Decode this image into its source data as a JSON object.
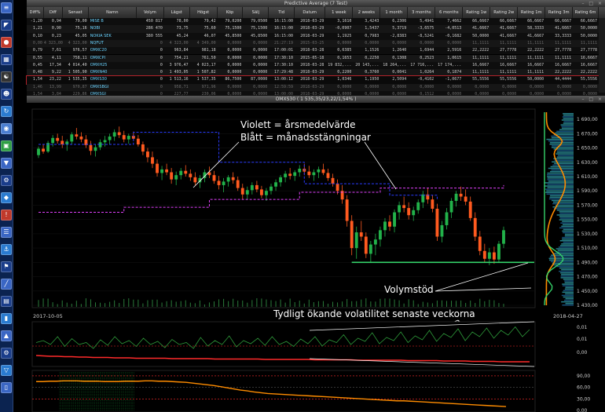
{
  "table_window": {
    "title": "Predictive Average (7 Test)",
    "controls": "– □ ×",
    "columns": [
      "Diff%",
      "Diff",
      "Senast",
      "Namn",
      "Volym",
      "Lägst",
      "Högst",
      "Köp",
      "Sälj",
      "Tid",
      "Datum",
      "1 week",
      "2 weeks",
      "1 month",
      "3 months",
      "6 months",
      "Rating 1w",
      "Rating 2w",
      "Rating 1m",
      "Rating 3m",
      "Rating 6m"
    ],
    "rows": [
      [
        "-1,20",
        "0,94",
        "79,00",
        "MISE B",
        "450 817",
        "78,00",
        "79,42",
        "79,0200",
        "79,0500",
        "16:15:00",
        "2018-03-29",
        "3,1610",
        "3,4243",
        "6,2306",
        "5,4941",
        "7,4662",
        "66,6667",
        "66,6667",
        "66,6667",
        "66,6667",
        "66,6667"
      ],
      [
        "1,21",
        "0,90",
        "75,16",
        "NOBI",
        "286 470",
        "73,75",
        "75,60",
        "75,1500",
        "75,1500",
        "16:15:00",
        "2018-03-29",
        "-0,0907",
        "1,5437",
        "5,3719",
        "-3,6575",
        "-4,0513",
        "41,6667",
        "41,6667",
        "58,3333",
        "41,6667",
        "50,0000"
      ],
      [
        "0,10",
        "0,23",
        "45,05",
        "NOKIA SEK",
        "380 555",
        "45,24",
        "46,07",
        "45,8500",
        "45,8500",
        "16:15:00",
        "2018-03-29",
        "1,1925",
        "0,7983",
        "-2,8383",
        "-8,5241",
        "-0,1682",
        "50,0000",
        "41,6667",
        "41,6667",
        "33,3333",
        "50,0000"
      ],
      [
        "0,00",
        "4 323,00",
        "4 323,00",
        "NQFUT",
        "0",
        "4 323,00",
        "4 349,00",
        "0,0000",
        "0,0000",
        "21:27:19",
        "2015-03-25",
        "0,0000",
        "0,0000",
        "0,0000",
        "0,0000",
        "0,0000",
        "11,1111",
        "11,1111",
        "11,1111",
        "11,1111",
        "11,1111"
      ],
      [
        "0,79",
        "7,61",
        "976,57",
        "OMXC20",
        "0",
        "963,84",
        "981,18",
        "0,0000",
        "0,0000",
        "17:00:01",
        "2018-03-28",
        "0,6385",
        "1,1526",
        "1,2640",
        "1,6944",
        "2,5916",
        "22,2222",
        "27,7778",
        "22,2222",
        "27,7778",
        "27,7778"
      ],
      [
        "0,55",
        "4,11",
        "758,11",
        "OMXCPI",
        "0",
        "754,21",
        "761,50",
        "0,0000",
        "0,0000",
        "17:30:10",
        "2015-05-18",
        "0,1653",
        "0,2250",
        "0,1308",
        "0,2523",
        "1,0615",
        "11,1111",
        "11,1111",
        "11,1111",
        "11,1111",
        "16,6667"
      ],
      [
        "0,45",
        "17,34",
        "4 014,40",
        "OMXH25",
        "0",
        "3 976,47",
        "4 023,17",
        "0,0000",
        "0,0000",
        "17:30:10",
        "2018-03-28",
        "19 832,...",
        "20 143,...",
        "18 264,...",
        "17 716,...",
        "17 174,...",
        "16,6667",
        "16,6667",
        "16,6667",
        "16,6667",
        "16,6667"
      ],
      [
        "0,48",
        "9,22",
        "1 505,90",
        "OMXN40",
        "0",
        "1 493,05",
        "1 507,82",
        "0,0000",
        "0,0000",
        "17:29:48",
        "2018-03-29",
        "0,2200",
        "0,3760",
        "0,0041",
        "1,0264",
        "0,1874",
        "11,1111",
        "11,1111",
        "11,1111",
        "22,2222",
        "22,2222"
      ],
      [
        "1,54",
        "23,22",
        "1 535,35",
        "OMXS30",
        "0",
        "1 513,16",
        "1 537,35",
        "86,7500",
        "87,0000",
        "13:00:12",
        "2018-03-29",
        "1,0346",
        "1,1950",
        "2,5094",
        "-0,4102",
        "-1,0677",
        "55,5556",
        "55,5556",
        "50,0000",
        "44,4444",
        "55,5556"
      ],
      [
        "1,46",
        "13,99",
        "970,87",
        "OMXSBGI",
        "0",
        "958,71",
        "971,96",
        "0,0000",
        "0,0000",
        "12:59:59",
        "2018-03-29",
        "0,0000",
        "0,0000",
        "0,0000",
        "0,0000",
        "0,0000",
        "0,0000",
        "0,0000",
        "0,0000",
        "0,0000",
        "0,0000"
      ],
      [
        "1,54",
        "3,84",
        "229,86",
        "OMXSGI",
        "0",
        "227,77",
        "230,06",
        "0,0000",
        "0,0000",
        "13:00:00",
        "2018-03-29",
        "0,0000",
        "0,0000",
        "0,0000",
        "0,1512",
        "0,0000",
        "0,0000",
        "0,0000",
        "0,0000",
        "0,0000",
        "0,0000"
      ]
    ]
  },
  "chart_window": {
    "title": "OMXS30 ( 1 535,35/23,22/1,54% )",
    "controls": "– □ ×",
    "annotations": {
      "violet": "Violett = årsmedelvärde",
      "blue": "Blått = månadsstängningar",
      "volume": "Volymstöd",
      "volatility": "Tydligt ökande volatilitet senaste veckorna"
    },
    "date_start": "2017-10-05",
    "date_end": "2018-04-27",
    "colors": {
      "up": "#22b24a",
      "down": "#ff5a1f",
      "violet": "#e040fb",
      "blue": "#2a3cff",
      "green_line": "#35d36a",
      "vol_red": "#ff2a2a",
      "indicator_orange": "#ff8c00"
    }
  },
  "chart_data": [
    {
      "type": "candlestick",
      "title": "OMXS30 ( 1 535,35/23,22/1,54% )",
      "xlabel": "",
      "ylabel": "",
      "x_range": [
        "2017-10-05",
        "2018-04-27"
      ],
      "ylim": [
        1430,
        1700
      ],
      "y_ticks": [
        "1 690,00",
        "1 670,00",
        "1 650,00",
        "1 630,00",
        "1 610,00",
        "1 590,00",
        "1 570,00",
        "1 550,00",
        "1 530,00",
        "1 510,00",
        "1 490,00",
        "1 470,00",
        "1 450,00",
        "1 430,00"
      ],
      "candles": [
        [
          1640,
          1652,
          1636,
          1649
        ],
        [
          1649,
          1655,
          1642,
          1645
        ],
        [
          1645,
          1660,
          1643,
          1657
        ],
        [
          1657,
          1668,
          1652,
          1664
        ],
        [
          1664,
          1670,
          1656,
          1660
        ],
        [
          1660,
          1667,
          1650,
          1655
        ],
        [
          1655,
          1662,
          1646,
          1659
        ],
        [
          1659,
          1672,
          1655,
          1669
        ],
        [
          1669,
          1678,
          1662,
          1666
        ],
        [
          1666,
          1672,
          1658,
          1662
        ],
        [
          1662,
          1668,
          1650,
          1654
        ],
        [
          1654,
          1660,
          1640,
          1646
        ],
        [
          1646,
          1655,
          1638,
          1651
        ],
        [
          1651,
          1662,
          1647,
          1658
        ],
        [
          1658,
          1667,
          1652,
          1661
        ],
        [
          1661,
          1670,
          1655,
          1666
        ],
        [
          1666,
          1676,
          1660,
          1672
        ],
        [
          1672,
          1680,
          1664,
          1668
        ],
        [
          1668,
          1674,
          1658,
          1662
        ],
        [
          1662,
          1670,
          1656,
          1667
        ],
        [
          1667,
          1673,
          1660,
          1663
        ],
        [
          1663,
          1668,
          1652,
          1655
        ],
        [
          1655,
          1659,
          1640,
          1645
        ],
        [
          1645,
          1650,
          1630,
          1637
        ],
        [
          1637,
          1645,
          1622,
          1628
        ],
        [
          1628,
          1634,
          1610,
          1615
        ],
        [
          1615,
          1625,
          1605,
          1620
        ],
        [
          1620,
          1628,
          1612,
          1616
        ],
        [
          1616,
          1622,
          1600,
          1606
        ],
        [
          1606,
          1617,
          1598,
          1612
        ],
        [
          1612,
          1622,
          1606,
          1618
        ],
        [
          1618,
          1626,
          1610,
          1614
        ],
        [
          1614,
          1620,
          1604,
          1609
        ],
        [
          1609,
          1616,
          1598,
          1602
        ],
        [
          1602,
          1612,
          1594,
          1608
        ],
        [
          1608,
          1620,
          1602,
          1616
        ],
        [
          1616,
          1624,
          1608,
          1612
        ],
        [
          1612,
          1618,
          1600,
          1604
        ],
        [
          1604,
          1611,
          1592,
          1598
        ],
        [
          1598,
          1608,
          1588,
          1603
        ],
        [
          1603,
          1612,
          1596,
          1609
        ],
        [
          1609,
          1616,
          1600,
          1605
        ],
        [
          1605,
          1610,
          1590,
          1594
        ],
        [
          1594,
          1600,
          1578,
          1585
        ],
        [
          1585,
          1596,
          1578,
          1591
        ],
        [
          1591,
          1602,
          1585,
          1598
        ],
        [
          1598,
          1604,
          1588,
          1592
        ],
        [
          1592,
          1597,
          1580,
          1584
        ],
        [
          1584,
          1594,
          1576,
          1590
        ],
        [
          1590,
          1600,
          1585,
          1596
        ],
        [
          1596,
          1606,
          1590,
          1602
        ],
        [
          1602,
          1612,
          1596,
          1609
        ],
        [
          1609,
          1618,
          1602,
          1614
        ],
        [
          1614,
          1622,
          1606,
          1611
        ],
        [
          1611,
          1619,
          1604,
          1616
        ],
        [
          1616,
          1626,
          1610,
          1621
        ],
        [
          1621,
          1628,
          1612,
          1617
        ],
        [
          1617,
          1625,
          1608,
          1612
        ],
        [
          1612,
          1620,
          1604,
          1616
        ],
        [
          1616,
          1624,
          1608,
          1620
        ],
        [
          1620,
          1628,
          1612,
          1615
        ],
        [
          1615,
          1621,
          1604,
          1608
        ],
        [
          1608,
          1614,
          1596,
          1600
        ],
        [
          1600,
          1606,
          1585,
          1590
        ],
        [
          1590,
          1598,
          1572,
          1578
        ],
        [
          1578,
          1584,
          1540,
          1548
        ],
        [
          1548,
          1556,
          1500,
          1510
        ],
        [
          1510,
          1540,
          1495,
          1532
        ],
        [
          1532,
          1548,
          1520,
          1526
        ],
        [
          1526,
          1532,
          1496,
          1502
        ],
        [
          1502,
          1520,
          1490,
          1515
        ],
        [
          1515,
          1530,
          1500,
          1522
        ],
        [
          1522,
          1540,
          1512,
          1535
        ],
        [
          1535,
          1552,
          1526,
          1547
        ],
        [
          1547,
          1556,
          1534,
          1540
        ],
        [
          1540,
          1564,
          1532,
          1560
        ],
        [
          1560,
          1575,
          1550,
          1570
        ],
        [
          1570,
          1582,
          1560,
          1566
        ],
        [
          1566,
          1574,
          1550,
          1556
        ],
        [
          1556,
          1568,
          1548,
          1563
        ],
        [
          1563,
          1578,
          1558,
          1574
        ],
        [
          1574,
          1590,
          1566,
          1585
        ],
        [
          1585,
          1594,
          1572,
          1578
        ],
        [
          1578,
          1584,
          1560,
          1565
        ],
        [
          1565,
          1572,
          1520,
          1526
        ],
        [
          1526,
          1548,
          1518,
          1542
        ],
        [
          1542,
          1566,
          1536,
          1560
        ],
        [
          1560,
          1580,
          1552,
          1576
        ],
        [
          1576,
          1590,
          1568,
          1586
        ],
        [
          1586,
          1596,
          1576,
          1582
        ],
        [
          1582,
          1592,
          1570,
          1575
        ],
        [
          1575,
          1582,
          1548,
          1552
        ],
        [
          1552,
          1560,
          1520,
          1526
        ],
        [
          1526,
          1534,
          1500,
          1506
        ],
        [
          1506,
          1516,
          1490,
          1495
        ],
        [
          1495,
          1510,
          1486,
          1504
        ],
        [
          1504,
          1512,
          1488,
          1494
        ],
        [
          1494,
          1520,
          1490,
          1516
        ],
        [
          1516,
          1540,
          1510,
          1535
        ]
      ],
      "yearly_avg": [
        [
          0,
          1560
        ],
        [
          18,
          1560
        ],
        [
          18,
          1567
        ],
        [
          36,
          1567
        ],
        [
          36,
          1578
        ],
        [
          55,
          1578
        ],
        [
          55,
          1588
        ],
        [
          72,
          1588
        ],
        [
          72,
          1594
        ],
        [
          98,
          1594
        ],
        [
          98,
          1598
        ]
      ],
      "monthly_close": [
        [
          0,
          1655
        ],
        [
          20,
          1655
        ],
        [
          20,
          1672
        ],
        [
          38,
          1672
        ],
        [
          38,
          1630
        ],
        [
          56,
          1630
        ],
        [
          56,
          1600
        ],
        [
          74,
          1600
        ],
        [
          74,
          1584
        ],
        [
          84,
          1584
        ],
        [
          84,
          1578
        ]
      ],
      "support_level": 1490
    },
    {
      "type": "line",
      "title": "",
      "xlabel": "",
      "ylabel": "",
      "y_ticks": [
        "0,01",
        "0,01",
        "0,00"
      ],
      "series": [
        {
          "values": [
            0.55,
            0.6,
            0.5,
            0.7,
            0.45,
            0.65,
            0.5,
            0.55,
            0.4,
            0.62,
            0.48,
            0.7,
            0.52,
            0.6,
            0.45,
            0.66,
            0.5,
            0.58,
            0.42,
            0.63,
            0.5,
            0.55,
            0.4,
            0.68,
            0.46,
            0.6,
            0.5,
            0.72,
            0.44,
            0.6,
            0.52,
            0.66,
            0.48,
            0.7,
            0.5,
            0.58,
            0.45,
            0.64,
            0.52,
            0.7,
            0.46,
            0.62,
            0.55,
            0.75,
            0.5,
            0.66,
            0.58,
            0.8,
            0.52,
            0.68,
            0.6,
            0.82,
            0.55,
            0.72,
            0.62,
            0.86,
            0.58,
            0.78,
            0.68,
            0.9,
            0.6,
            0.82,
            0.7,
            0.92,
            0.66,
            0.86,
            0.74,
            0.95,
            0.7,
            0.88
          ]
        },
        {
          "values": [
            0.22,
            0.21,
            0.2,
            0.2,
            0.19,
            0.19,
            0.18,
            0.18,
            0.17,
            0.17,
            0.17,
            0.16,
            0.16,
            0.16,
            0.15,
            0.15,
            0.15,
            0.15,
            0.15,
            0.14,
            0.14,
            0.14,
            0.14,
            0.14,
            0.14,
            0.13,
            0.13,
            0.13,
            0.13,
            0.13,
            0.13,
            0.13,
            0.12,
            0.12,
            0.12,
            0.12,
            0.12,
            0.12,
            0.12,
            0.11,
            0.11,
            0.11,
            0.11,
            0.11,
            0.11,
            0.1,
            0.1,
            0.1,
            0.1,
            0.1,
            0.1,
            0.1,
            0.09,
            0.09,
            0.09,
            0.09,
            0.09,
            0.08,
            0.08,
            0.08,
            0.08,
            0.07,
            0.07,
            0.07,
            0.07,
            0.06,
            0.06,
            0.06,
            0.06,
            0.06
          ]
        }
      ]
    },
    {
      "type": "line",
      "title": "",
      "xlabel": "",
      "ylabel": "",
      "ylim": [
        0,
        100
      ],
      "y_ticks": [
        "90,00",
        "60,00",
        "30,00",
        "0,00"
      ],
      "series": [
        {
          "values": [
            75,
            75,
            76,
            76,
            77,
            77,
            77,
            76,
            76,
            76,
            75,
            75,
            75,
            76,
            76,
            76,
            77,
            77,
            76,
            76,
            75,
            74,
            73,
            71,
            69,
            67,
            65,
            62,
            59,
            56,
            53,
            51,
            48,
            46,
            44,
            43,
            42,
            41,
            40,
            39,
            38,
            37,
            36,
            35,
            34,
            33,
            32,
            31,
            30,
            29,
            28,
            27,
            26,
            25,
            25,
            24,
            23,
            22,
            21,
            20,
            19,
            18,
            17,
            16,
            15,
            14,
            13,
            12,
            11,
            10
          ]
        }
      ]
    }
  ]
}
